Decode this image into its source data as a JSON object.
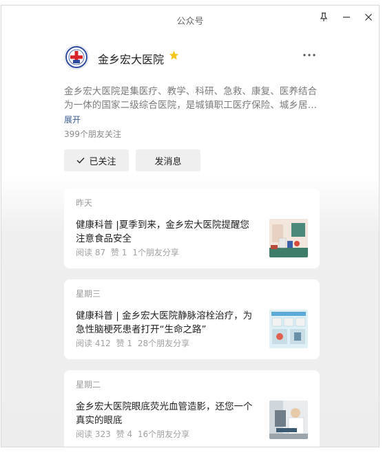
{
  "window": {
    "title": "公众号"
  },
  "account": {
    "name": "金乡宏大医院",
    "description": "金乡宏大医院是集医疗、教学、科研、急救、康复、医养结合为一体的国家二级综合医院，是城镇职工医疗保险、城乡居民医疗保险定点医院。",
    "expand_label": "展开",
    "followers": "399个朋友关注",
    "follow_label": "已关注",
    "message_label": "发消息"
  },
  "colors": {
    "star": "#f5c518",
    "link": "#3a5a8c"
  },
  "articles": [
    {
      "date": "昨天",
      "title": "健康科普 |夏季到来，金乡宏大医院提醒您注意食品安全",
      "reads": "阅读 87",
      "likes": "赞 1",
      "shares": "1个朋友分享"
    },
    {
      "date": "星期三",
      "title": "健康科普 | 金乡宏大医院静脉溶栓治疗，为急性脑梗死患者打开“生命之路”",
      "reads": "阅读 412",
      "likes": "赞 1",
      "shares": "28个朋友分享"
    },
    {
      "date": "星期二",
      "title": "金乡宏大医院眼底荧光血管造影，还您一个真实的眼底",
      "reads": "阅读 323",
      "likes": "赞 4",
      "shares": "16个朋友分享"
    }
  ]
}
